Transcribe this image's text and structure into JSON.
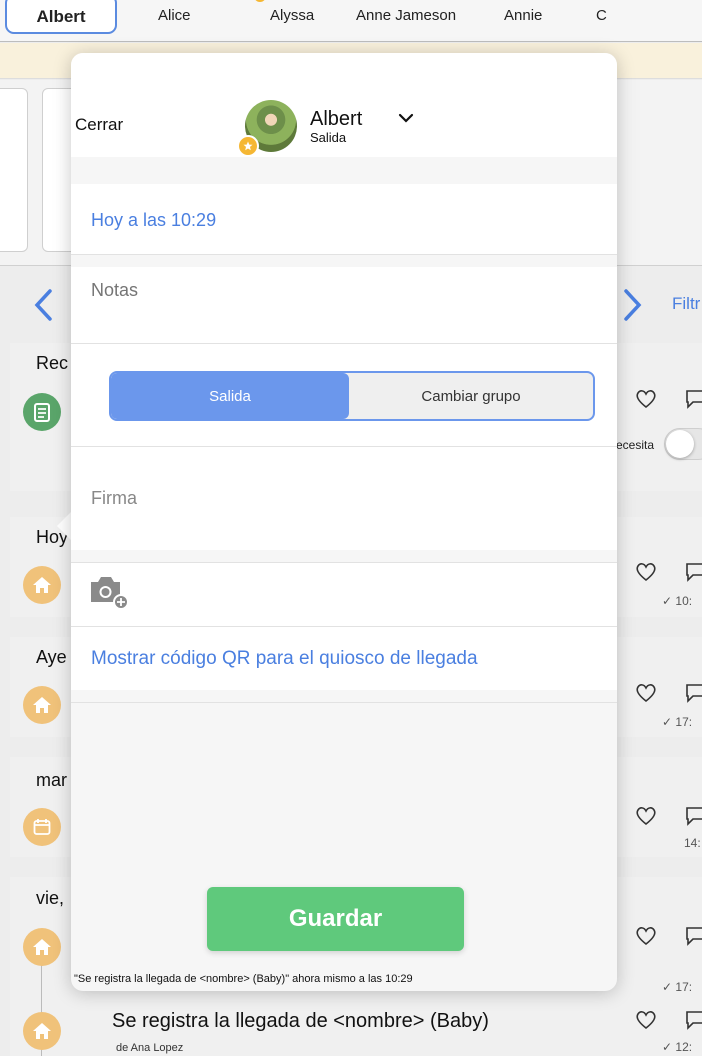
{
  "tabs": [
    "Albert",
    "Alice",
    "Alyssa",
    "Anne Jameson",
    "Annie",
    "C"
  ],
  "filter_label": "Filtr",
  "days": [
    {
      "label": "Rec"
    },
    {
      "label": "Hoy"
    },
    {
      "label": "Aye"
    },
    {
      "label": "mar"
    },
    {
      "label": "vie,"
    }
  ],
  "times": [
    "10:",
    "17:",
    "14:",
    "17:",
    "12:"
  ],
  "toggle_label": "ecesita",
  "feed_item": {
    "title": "Se registra la llegada de <nombre> (Baby)",
    "author": "de Ana Lopez"
  },
  "popover": {
    "close_label": "Cerrar",
    "child_name": "Albert",
    "child_status": "Salida",
    "date_label": "Hoy a las 10:29",
    "notes_placeholder": "Notas",
    "segment": {
      "selected": "Salida",
      "other": "Cambiar grupo"
    },
    "signature_label": "Firma",
    "qr_link": "Mostrar código QR para el quiosco de llegada",
    "save_label": "Guardar",
    "preview_note": "\"Se registra la llegada de <nombre> (Baby)\" ahora mismo a las 10:29"
  },
  "colors": {
    "accent_blue": "#4a7fe0",
    "segment_blue": "#6b97ec",
    "save_green": "#5fc97c",
    "badge_yellow": "#f5b733",
    "home_orange": "#f0c27a",
    "notes_green": "#5aa56a"
  },
  "icons": [
    "chevron-left-icon",
    "chevron-right-icon",
    "chevron-down-icon",
    "heart-icon",
    "comment-icon",
    "home-icon",
    "calendar-icon",
    "clipboard-icon",
    "camera-icon",
    "star-badge-icon"
  ]
}
